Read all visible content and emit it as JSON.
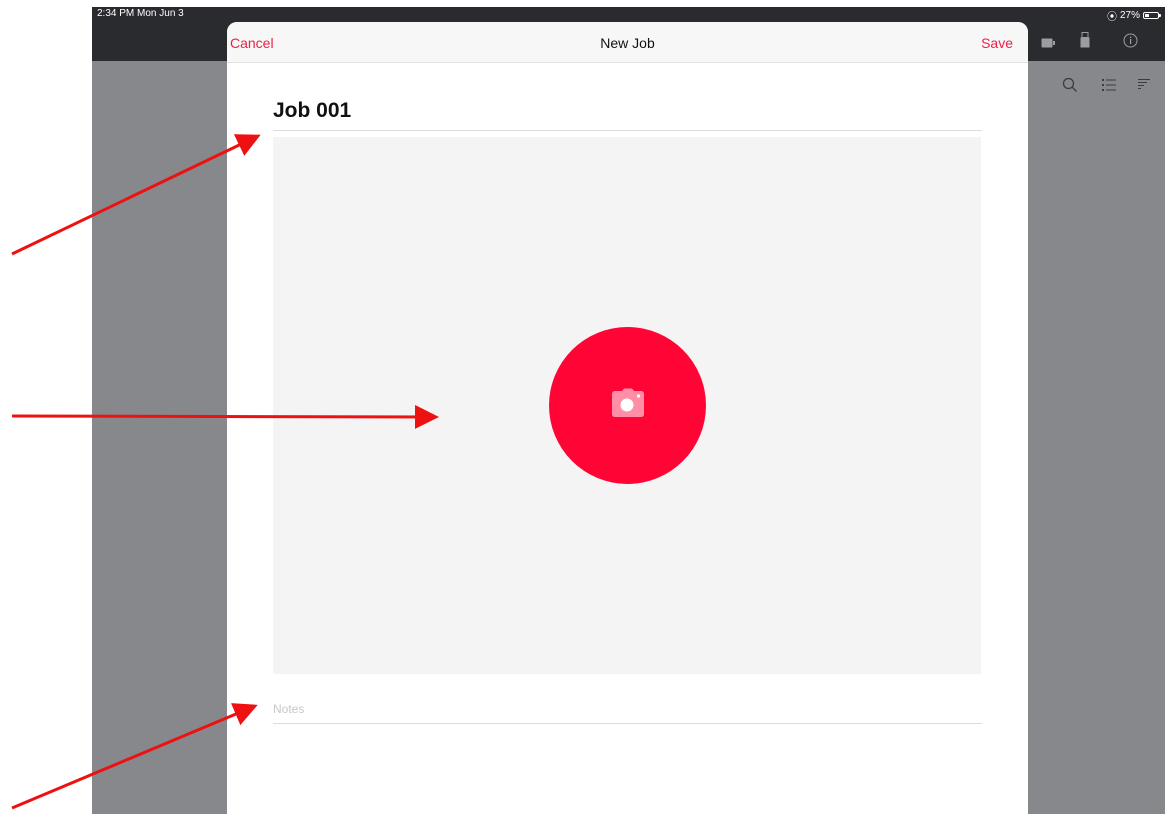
{
  "status_bar": {
    "time": "2:34 PM  Mon Jun 3",
    "battery_text": "27%",
    "battery_level": 0.27
  },
  "background_toolbar": {
    "icons": [
      "battery-icon",
      "usb-drive-icon",
      "info-icon"
    ],
    "subtoolbar_icons": [
      "search-icon",
      "list-icon",
      "sort-icon"
    ]
  },
  "modal": {
    "cancel_label": "Cancel",
    "title": "New Job",
    "save_label": "Save",
    "job_name": "Job 001",
    "notes_placeholder": "Notes",
    "camera_icon": "camera-icon"
  },
  "colors": {
    "accent": "#e8224a",
    "camera_button": "#ff0536",
    "arrows": "#ee1111",
    "backdrop": "#87888c",
    "topbar": "#2a2b2e"
  }
}
